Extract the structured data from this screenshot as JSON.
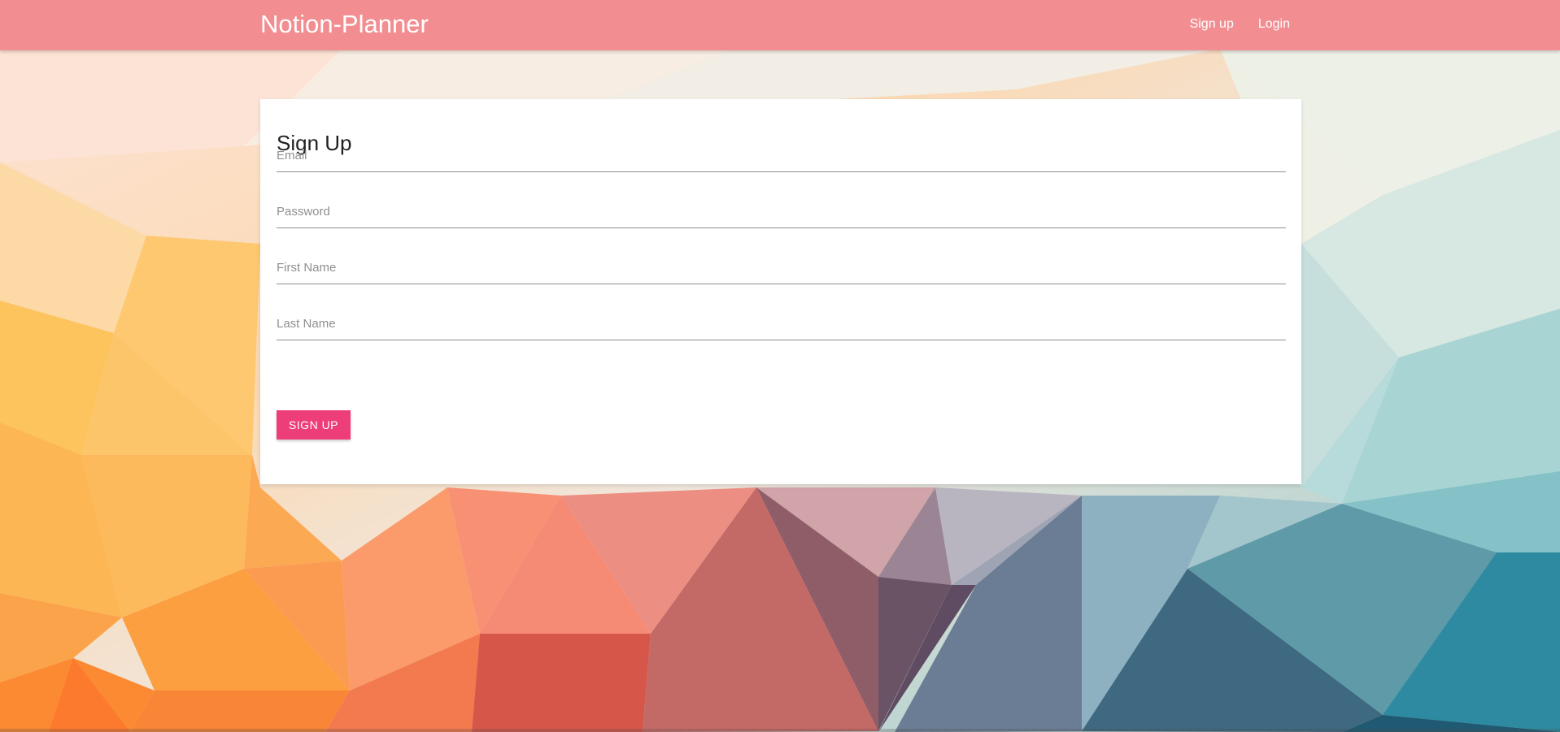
{
  "colors": {
    "navbar": "#f28e91",
    "button": "#ee3e7a"
  },
  "navbar": {
    "brand": "Notion-Planner",
    "links": [
      "Sign up",
      "Login"
    ]
  },
  "form": {
    "title": "Sign Up",
    "fields": [
      {
        "placeholder": "Email",
        "value": ""
      },
      {
        "placeholder": "Password",
        "value": ""
      },
      {
        "placeholder": "First Name",
        "value": ""
      },
      {
        "placeholder": "Last Name",
        "value": ""
      }
    ],
    "submit_label": "SIGN UP"
  }
}
